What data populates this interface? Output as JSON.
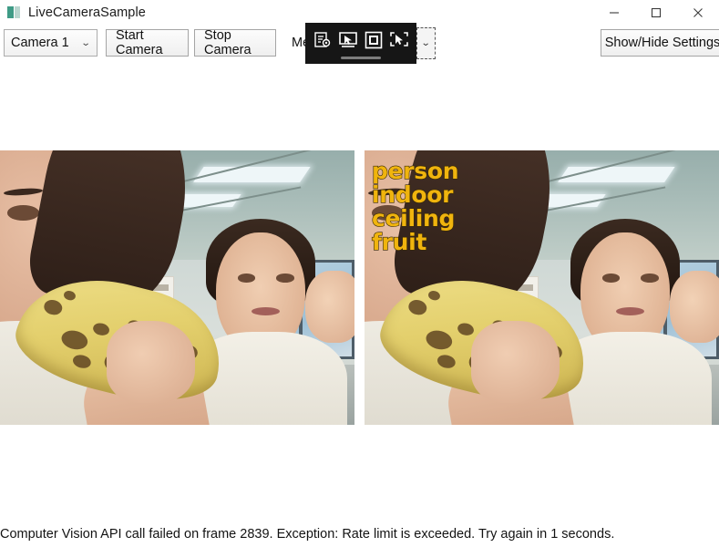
{
  "window": {
    "title": "LiveCameraSample",
    "icon": "app-icon",
    "controls": {
      "minimize": "minimize-icon",
      "maximize": "maximize-icon",
      "close": "close-icon"
    }
  },
  "toolbar": {
    "camera_select": {
      "value": "Camera 1",
      "chevron": "⌄",
      "options": [
        "Camera 1"
      ]
    },
    "start_camera_label": "Start Camera",
    "stop_camera_label": "Stop Camera",
    "mode_label_truncated": "Me",
    "show_hide_settings_label": "Show/Hide Settings"
  },
  "capture_toolbar": {
    "icons": [
      "form-settings-icon",
      "window-select-icon",
      "region-square-icon",
      "freeform-select-icon"
    ],
    "grip": "drag-handle",
    "expand_chevron": "⌄"
  },
  "video": {
    "left_frame_label": "raw-camera-frame",
    "right_frame_label": "analyzed-camera-frame",
    "tags": [
      "person",
      "indoor",
      "ceiling",
      "fruit"
    ],
    "tag_color": "#f0b40e",
    "tag_outline_color": "#3a2a05"
  },
  "status": {
    "message": "Computer Vision API call failed on frame 2839. Exception: Rate limit is exceeded. Try again in 1 seconds."
  },
  "colors": {
    "background": "#ffffff",
    "button_face": "#f0f0f0",
    "button_border": "#a5a5a5",
    "capture_toolbar_bg": "#161616"
  }
}
